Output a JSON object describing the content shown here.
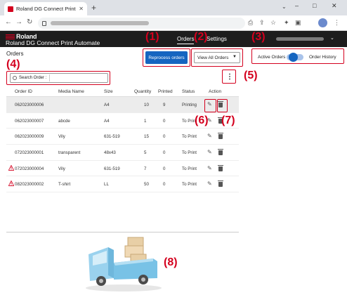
{
  "browser": {
    "tab_title": "Roland DG Connect Print Automate",
    "tab_close": "✕",
    "new_tab": "+",
    "tab_list": "⌄",
    "window_controls": [
      "–",
      "□",
      "✕"
    ],
    "nav": {
      "back": "←",
      "forward": "→",
      "reload": "↻"
    },
    "toolbar_icons": [
      "⎙",
      "⇪",
      "☆",
      "✦",
      "▣",
      "⋮"
    ]
  },
  "app": {
    "brand": "Roland",
    "title": "Roland DG Connect Print Automate",
    "nav": {
      "orders": "Orders",
      "settings": "Settings"
    },
    "user_chevron": "⌄"
  },
  "page": {
    "title": "Orders",
    "reprocess_label": "Reprocess orders",
    "filter_selected": "View All Orders",
    "filter_chevron": "▼",
    "toggle_active": "Active Orders",
    "toggle_history": "Order History",
    "search_label": "Search Order :",
    "search_value": "",
    "kebab": "⋮"
  },
  "table": {
    "headers": [
      "Order ID",
      "Media Name",
      "Size",
      "Quantity",
      "Printed",
      "Status",
      "Action"
    ],
    "rows": [
      {
        "id": "062023000006",
        "media": "",
        "size": "A4",
        "qty": "10",
        "printed": "9",
        "status": "Printing",
        "warn": false
      },
      {
        "id": "062023000007",
        "media": "abcde",
        "size": "A4",
        "qty": "1",
        "printed": "0",
        "status": "To Print",
        "warn": false
      },
      {
        "id": "062023000009",
        "media": "Vily",
        "size": "631-519",
        "qty": "15",
        "printed": "0",
        "status": "To Print",
        "warn": false
      },
      {
        "id": "072023000001",
        "media": "transparent",
        "size": "48x43",
        "qty": "5",
        "printed": "0",
        "status": "To Print",
        "warn": false
      },
      {
        "id": "072023000004",
        "media": "Vily",
        "size": "631-519",
        "qty": "7",
        "printed": "0",
        "status": "To Print",
        "warn": true
      },
      {
        "id": "082023000002",
        "media": "T-shirt",
        "size": "LL",
        "qty": "50",
        "printed": "0",
        "status": "To Print",
        "warn": true
      }
    ],
    "action_icons": {
      "edit": "✎",
      "delete": "trash"
    }
  },
  "callouts": [
    "(1)",
    "(2)",
    "(3)",
    "(4)",
    "(5)",
    "(6)",
    "(7)",
    "(8)"
  ],
  "colors": {
    "accent": "#1565c0",
    "annotation": "#d4001e",
    "header": "#1d1d1d",
    "warning": "#d4001e"
  }
}
